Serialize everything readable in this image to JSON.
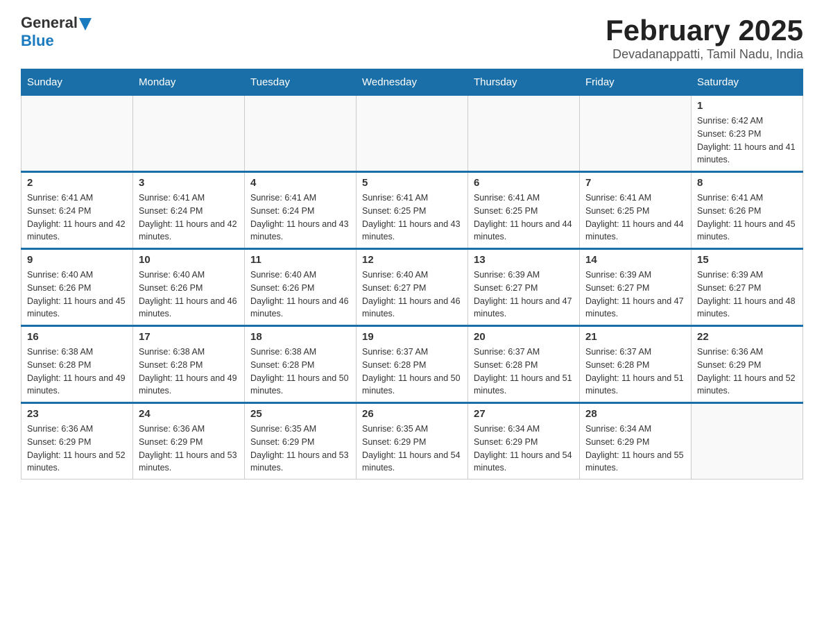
{
  "logo": {
    "general": "General",
    "blue": "Blue"
  },
  "title": "February 2025",
  "location": "Devadanappatti, Tamil Nadu, India",
  "weekdays": [
    "Sunday",
    "Monday",
    "Tuesday",
    "Wednesday",
    "Thursday",
    "Friday",
    "Saturday"
  ],
  "weeks": [
    [
      {
        "day": "",
        "sunrise": "",
        "sunset": "",
        "daylight": ""
      },
      {
        "day": "",
        "sunrise": "",
        "sunset": "",
        "daylight": ""
      },
      {
        "day": "",
        "sunrise": "",
        "sunset": "",
        "daylight": ""
      },
      {
        "day": "",
        "sunrise": "",
        "sunset": "",
        "daylight": ""
      },
      {
        "day": "",
        "sunrise": "",
        "sunset": "",
        "daylight": ""
      },
      {
        "day": "",
        "sunrise": "",
        "sunset": "",
        "daylight": ""
      },
      {
        "day": "1",
        "sunrise": "Sunrise: 6:42 AM",
        "sunset": "Sunset: 6:23 PM",
        "daylight": "Daylight: 11 hours and 41 minutes."
      }
    ],
    [
      {
        "day": "2",
        "sunrise": "Sunrise: 6:41 AM",
        "sunset": "Sunset: 6:24 PM",
        "daylight": "Daylight: 11 hours and 42 minutes."
      },
      {
        "day": "3",
        "sunrise": "Sunrise: 6:41 AM",
        "sunset": "Sunset: 6:24 PM",
        "daylight": "Daylight: 11 hours and 42 minutes."
      },
      {
        "day": "4",
        "sunrise": "Sunrise: 6:41 AM",
        "sunset": "Sunset: 6:24 PM",
        "daylight": "Daylight: 11 hours and 43 minutes."
      },
      {
        "day": "5",
        "sunrise": "Sunrise: 6:41 AM",
        "sunset": "Sunset: 6:25 PM",
        "daylight": "Daylight: 11 hours and 43 minutes."
      },
      {
        "day": "6",
        "sunrise": "Sunrise: 6:41 AM",
        "sunset": "Sunset: 6:25 PM",
        "daylight": "Daylight: 11 hours and 44 minutes."
      },
      {
        "day": "7",
        "sunrise": "Sunrise: 6:41 AM",
        "sunset": "Sunset: 6:25 PM",
        "daylight": "Daylight: 11 hours and 44 minutes."
      },
      {
        "day": "8",
        "sunrise": "Sunrise: 6:41 AM",
        "sunset": "Sunset: 6:26 PM",
        "daylight": "Daylight: 11 hours and 45 minutes."
      }
    ],
    [
      {
        "day": "9",
        "sunrise": "Sunrise: 6:40 AM",
        "sunset": "Sunset: 6:26 PM",
        "daylight": "Daylight: 11 hours and 45 minutes."
      },
      {
        "day": "10",
        "sunrise": "Sunrise: 6:40 AM",
        "sunset": "Sunset: 6:26 PM",
        "daylight": "Daylight: 11 hours and 46 minutes."
      },
      {
        "day": "11",
        "sunrise": "Sunrise: 6:40 AM",
        "sunset": "Sunset: 6:26 PM",
        "daylight": "Daylight: 11 hours and 46 minutes."
      },
      {
        "day": "12",
        "sunrise": "Sunrise: 6:40 AM",
        "sunset": "Sunset: 6:27 PM",
        "daylight": "Daylight: 11 hours and 46 minutes."
      },
      {
        "day": "13",
        "sunrise": "Sunrise: 6:39 AM",
        "sunset": "Sunset: 6:27 PM",
        "daylight": "Daylight: 11 hours and 47 minutes."
      },
      {
        "day": "14",
        "sunrise": "Sunrise: 6:39 AM",
        "sunset": "Sunset: 6:27 PM",
        "daylight": "Daylight: 11 hours and 47 minutes."
      },
      {
        "day": "15",
        "sunrise": "Sunrise: 6:39 AM",
        "sunset": "Sunset: 6:27 PM",
        "daylight": "Daylight: 11 hours and 48 minutes."
      }
    ],
    [
      {
        "day": "16",
        "sunrise": "Sunrise: 6:38 AM",
        "sunset": "Sunset: 6:28 PM",
        "daylight": "Daylight: 11 hours and 49 minutes."
      },
      {
        "day": "17",
        "sunrise": "Sunrise: 6:38 AM",
        "sunset": "Sunset: 6:28 PM",
        "daylight": "Daylight: 11 hours and 49 minutes."
      },
      {
        "day": "18",
        "sunrise": "Sunrise: 6:38 AM",
        "sunset": "Sunset: 6:28 PM",
        "daylight": "Daylight: 11 hours and 50 minutes."
      },
      {
        "day": "19",
        "sunrise": "Sunrise: 6:37 AM",
        "sunset": "Sunset: 6:28 PM",
        "daylight": "Daylight: 11 hours and 50 minutes."
      },
      {
        "day": "20",
        "sunrise": "Sunrise: 6:37 AM",
        "sunset": "Sunset: 6:28 PM",
        "daylight": "Daylight: 11 hours and 51 minutes."
      },
      {
        "day": "21",
        "sunrise": "Sunrise: 6:37 AM",
        "sunset": "Sunset: 6:28 PM",
        "daylight": "Daylight: 11 hours and 51 minutes."
      },
      {
        "day": "22",
        "sunrise": "Sunrise: 6:36 AM",
        "sunset": "Sunset: 6:29 PM",
        "daylight": "Daylight: 11 hours and 52 minutes."
      }
    ],
    [
      {
        "day": "23",
        "sunrise": "Sunrise: 6:36 AM",
        "sunset": "Sunset: 6:29 PM",
        "daylight": "Daylight: 11 hours and 52 minutes."
      },
      {
        "day": "24",
        "sunrise": "Sunrise: 6:36 AM",
        "sunset": "Sunset: 6:29 PM",
        "daylight": "Daylight: 11 hours and 53 minutes."
      },
      {
        "day": "25",
        "sunrise": "Sunrise: 6:35 AM",
        "sunset": "Sunset: 6:29 PM",
        "daylight": "Daylight: 11 hours and 53 minutes."
      },
      {
        "day": "26",
        "sunrise": "Sunrise: 6:35 AM",
        "sunset": "Sunset: 6:29 PM",
        "daylight": "Daylight: 11 hours and 54 minutes."
      },
      {
        "day": "27",
        "sunrise": "Sunrise: 6:34 AM",
        "sunset": "Sunset: 6:29 PM",
        "daylight": "Daylight: 11 hours and 54 minutes."
      },
      {
        "day": "28",
        "sunrise": "Sunrise: 6:34 AM",
        "sunset": "Sunset: 6:29 PM",
        "daylight": "Daylight: 11 hours and 55 minutes."
      },
      {
        "day": "",
        "sunrise": "",
        "sunset": "",
        "daylight": ""
      }
    ]
  ]
}
